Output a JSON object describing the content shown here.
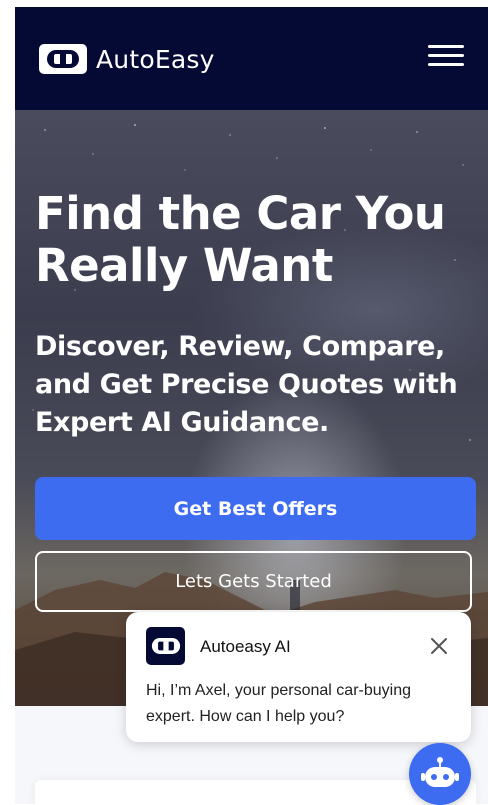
{
  "brand": {
    "name": "AutoEasy",
    "logo_icon": "car-icon"
  },
  "nav": {
    "menu_icon": "hamburger-menu-icon"
  },
  "hero": {
    "title": "Find the Car You Really Want",
    "subtitle": "Discover, Review, Compare, and Get Precise Quotes with Expert AI Guidance.",
    "primary_cta": "Get Best Offers",
    "secondary_cta": "Lets Gets Started"
  },
  "chat": {
    "name": "Autoeasy AI",
    "message": "Hi, I’m Axel, your personal car-buying expert.  How can I help you?",
    "close_icon": "close-icon",
    "fab_icon": "chatbot-icon"
  },
  "colors": {
    "navbar": "#050a35",
    "accent": "#3e6cf0",
    "white": "#ffffff"
  }
}
